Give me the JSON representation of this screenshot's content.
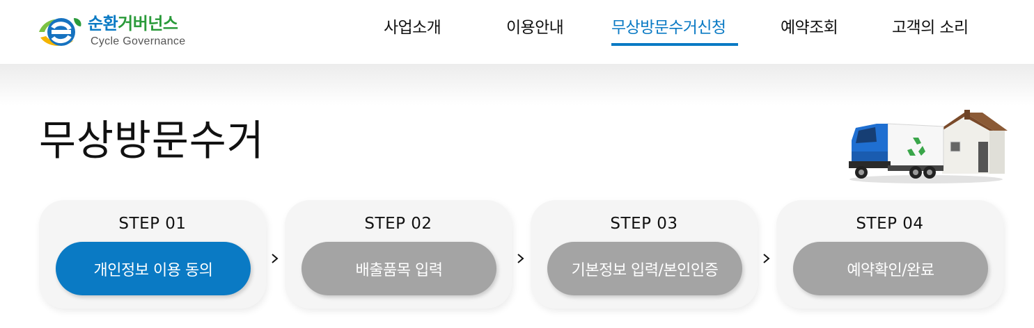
{
  "header": {
    "logo": {
      "name_ko_part1": "순환",
      "name_ko_part2": "거버넌스",
      "name_en": "Cycle Governance",
      "icon": "e-logo-icon"
    },
    "nav": [
      {
        "label": "사업소개",
        "active": false
      },
      {
        "label": "이용안내",
        "active": false
      },
      {
        "label": "무상방문수거신청",
        "active": true
      },
      {
        "label": "예약조회",
        "active": false
      },
      {
        "label": "고객의 소리",
        "active": false
      }
    ]
  },
  "main": {
    "title": "무상방문수거",
    "illustration": "recycling-truck-house-illustration",
    "steps": [
      {
        "label": "STEP 01",
        "button": "개인정보 이용 동의",
        "active": true
      },
      {
        "label": "STEP 02",
        "button": "배출품목 입력",
        "active": false
      },
      {
        "label": "STEP 03",
        "button": "기본정보 입력/본인인증",
        "active": false
      },
      {
        "label": "STEP 04",
        "button": "예약확인/완료",
        "active": false
      }
    ],
    "arrow_icon": "chevron-right-icon"
  },
  "colors": {
    "primary": "#0a7ac4",
    "logo_green": "#2a9a3a",
    "inactive_button": "#a4a4a4",
    "card_bg": "#f5f5f5"
  }
}
